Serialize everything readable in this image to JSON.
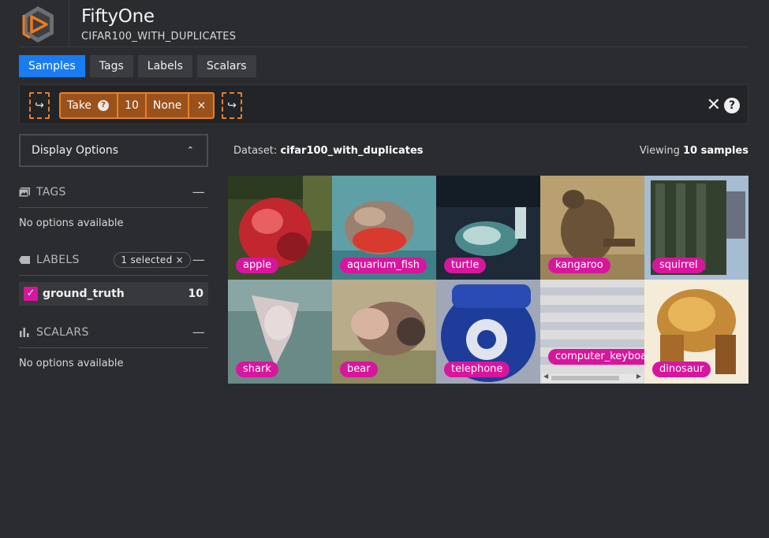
{
  "header": {
    "app_title": "FiftyOne",
    "dataset_name": "CIFAR100_WITH_DUPLICATES",
    "logo_icon": "fiftyone-logo-icon"
  },
  "tabs": [
    {
      "label": "Samples",
      "active": true
    },
    {
      "label": "Tags",
      "active": false
    },
    {
      "label": "Labels",
      "active": false
    },
    {
      "label": "Scalars",
      "active": false
    }
  ],
  "view_bar": {
    "add_stage_icon": "↪",
    "stage": {
      "name": "Take",
      "help_icon": "?",
      "size": "10",
      "seed": "None",
      "remove_icon": "×"
    },
    "close_icon": "✕",
    "help_icon": "?"
  },
  "sidebar": {
    "display_options": {
      "label": "Display Options",
      "chevron": "⌃"
    },
    "tags": {
      "title": "TAGS",
      "collapse": "—",
      "empty": "No options available"
    },
    "labels": {
      "title": "LABELS",
      "collapse": "—",
      "selected_pill": "1 selected ×",
      "fields": [
        {
          "name": "ground_truth",
          "count": "10",
          "checked": true,
          "check_mark": "✓",
          "color": "#d8159d"
        }
      ]
    },
    "scalars": {
      "title": "SCALARS",
      "collapse": "—",
      "empty": "No options available"
    }
  },
  "dataset_info": {
    "prefix": "Dataset:",
    "name": "cifar100_with_duplicates"
  },
  "viewing": {
    "prefix": "Viewing",
    "count": "10 samples"
  },
  "samples": [
    {
      "label": "apple",
      "selected": false
    },
    {
      "label": "aquarium_fish",
      "selected": false
    },
    {
      "label": "turtle",
      "selected": false
    },
    {
      "label": "kangaroo",
      "selected": false
    },
    {
      "label": "squirrel",
      "selected": true
    },
    {
      "label": "shark",
      "selected": false
    },
    {
      "label": "bear",
      "selected": true
    },
    {
      "label": "telephone",
      "selected": false
    },
    {
      "label": "computer_keyboard",
      "selected": false
    },
    {
      "label": "dinosaur",
      "selected": true
    }
  ],
  "colors": {
    "accent": "#1a7cf2",
    "stage_orange": "#e8802c",
    "label_pink": "#d8159d"
  }
}
